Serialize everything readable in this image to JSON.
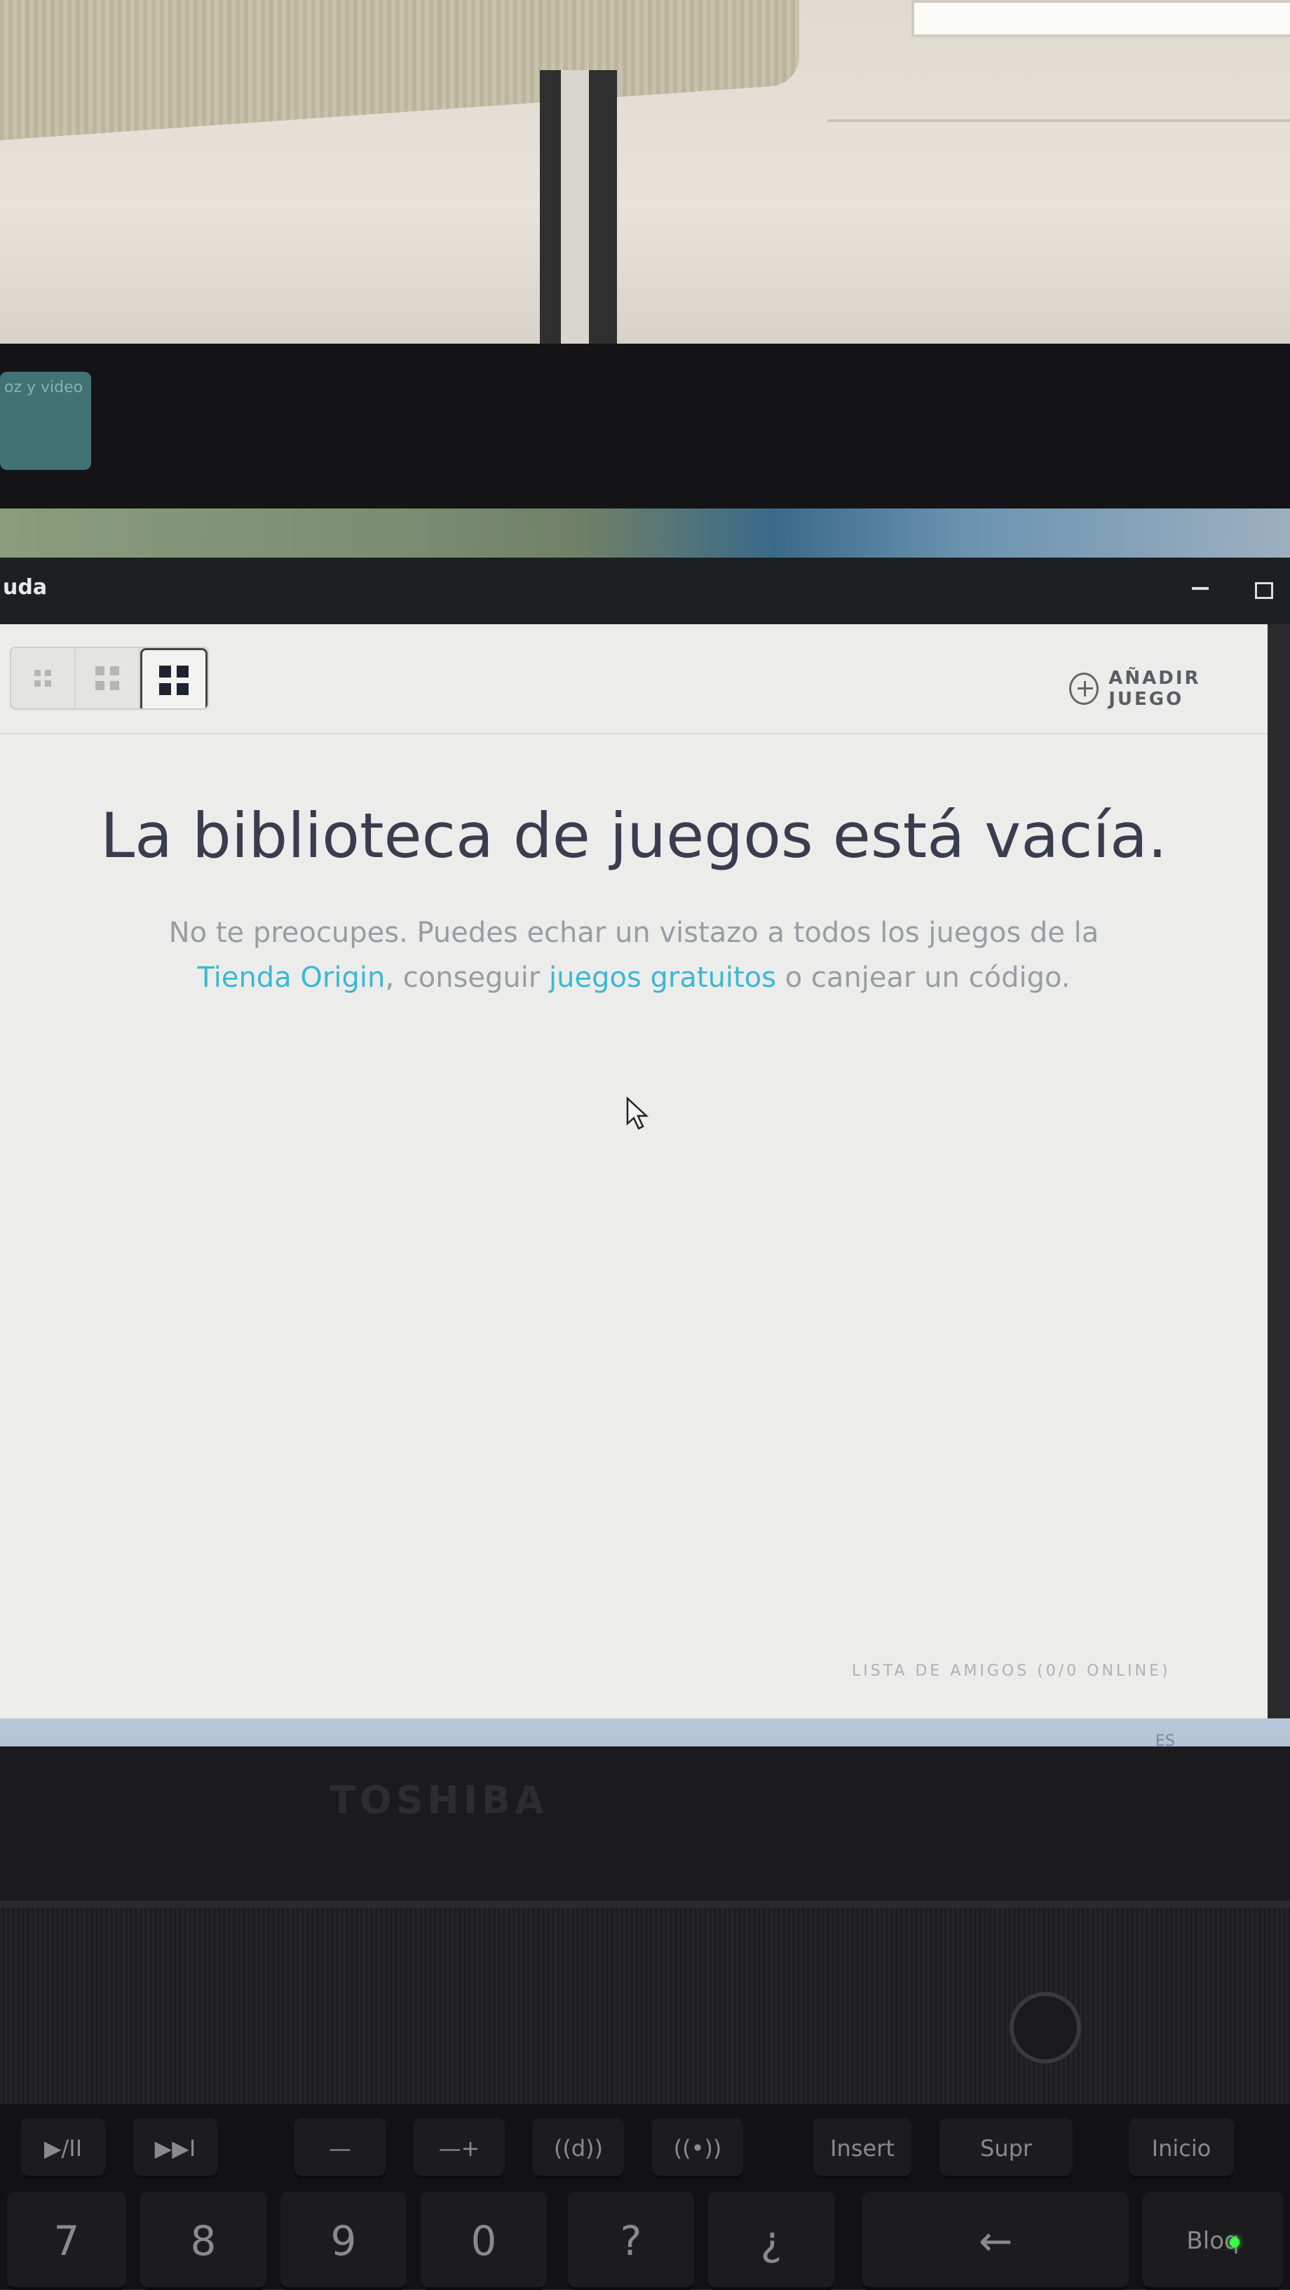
{
  "desktop": {
    "icon_label": "oz y video"
  },
  "window": {
    "title": "uda"
  },
  "toolbar": {
    "add_game_label": "AÑADIR JUEGO"
  },
  "empty_state": {
    "title": "La biblioteca de juegos está vacía.",
    "line1": "No te preocupes. Puedes echar un vistazo a todos los juegos de la",
    "link_store": "Tienda Origin",
    "sep": ", conseguir ",
    "link_free": "juegos gratuitos",
    "tail": " o canjear un código."
  },
  "footer": {
    "friends_list": "LISTA DE AMIGOS (0/0 ONLINE)"
  },
  "taskbar": {
    "language": "ES"
  },
  "laptop": {
    "brand": "TOSHIBA",
    "fkeys": [
      "▶/II",
      "▶▶I",
      "—",
      "—+",
      "((d))",
      "((•))",
      "Insert",
      "Supr",
      "Inicio"
    ],
    "numkeys": [
      "7",
      "8",
      "9",
      "0",
      "?",
      "¿",
      "←",
      "Bloq"
    ]
  }
}
